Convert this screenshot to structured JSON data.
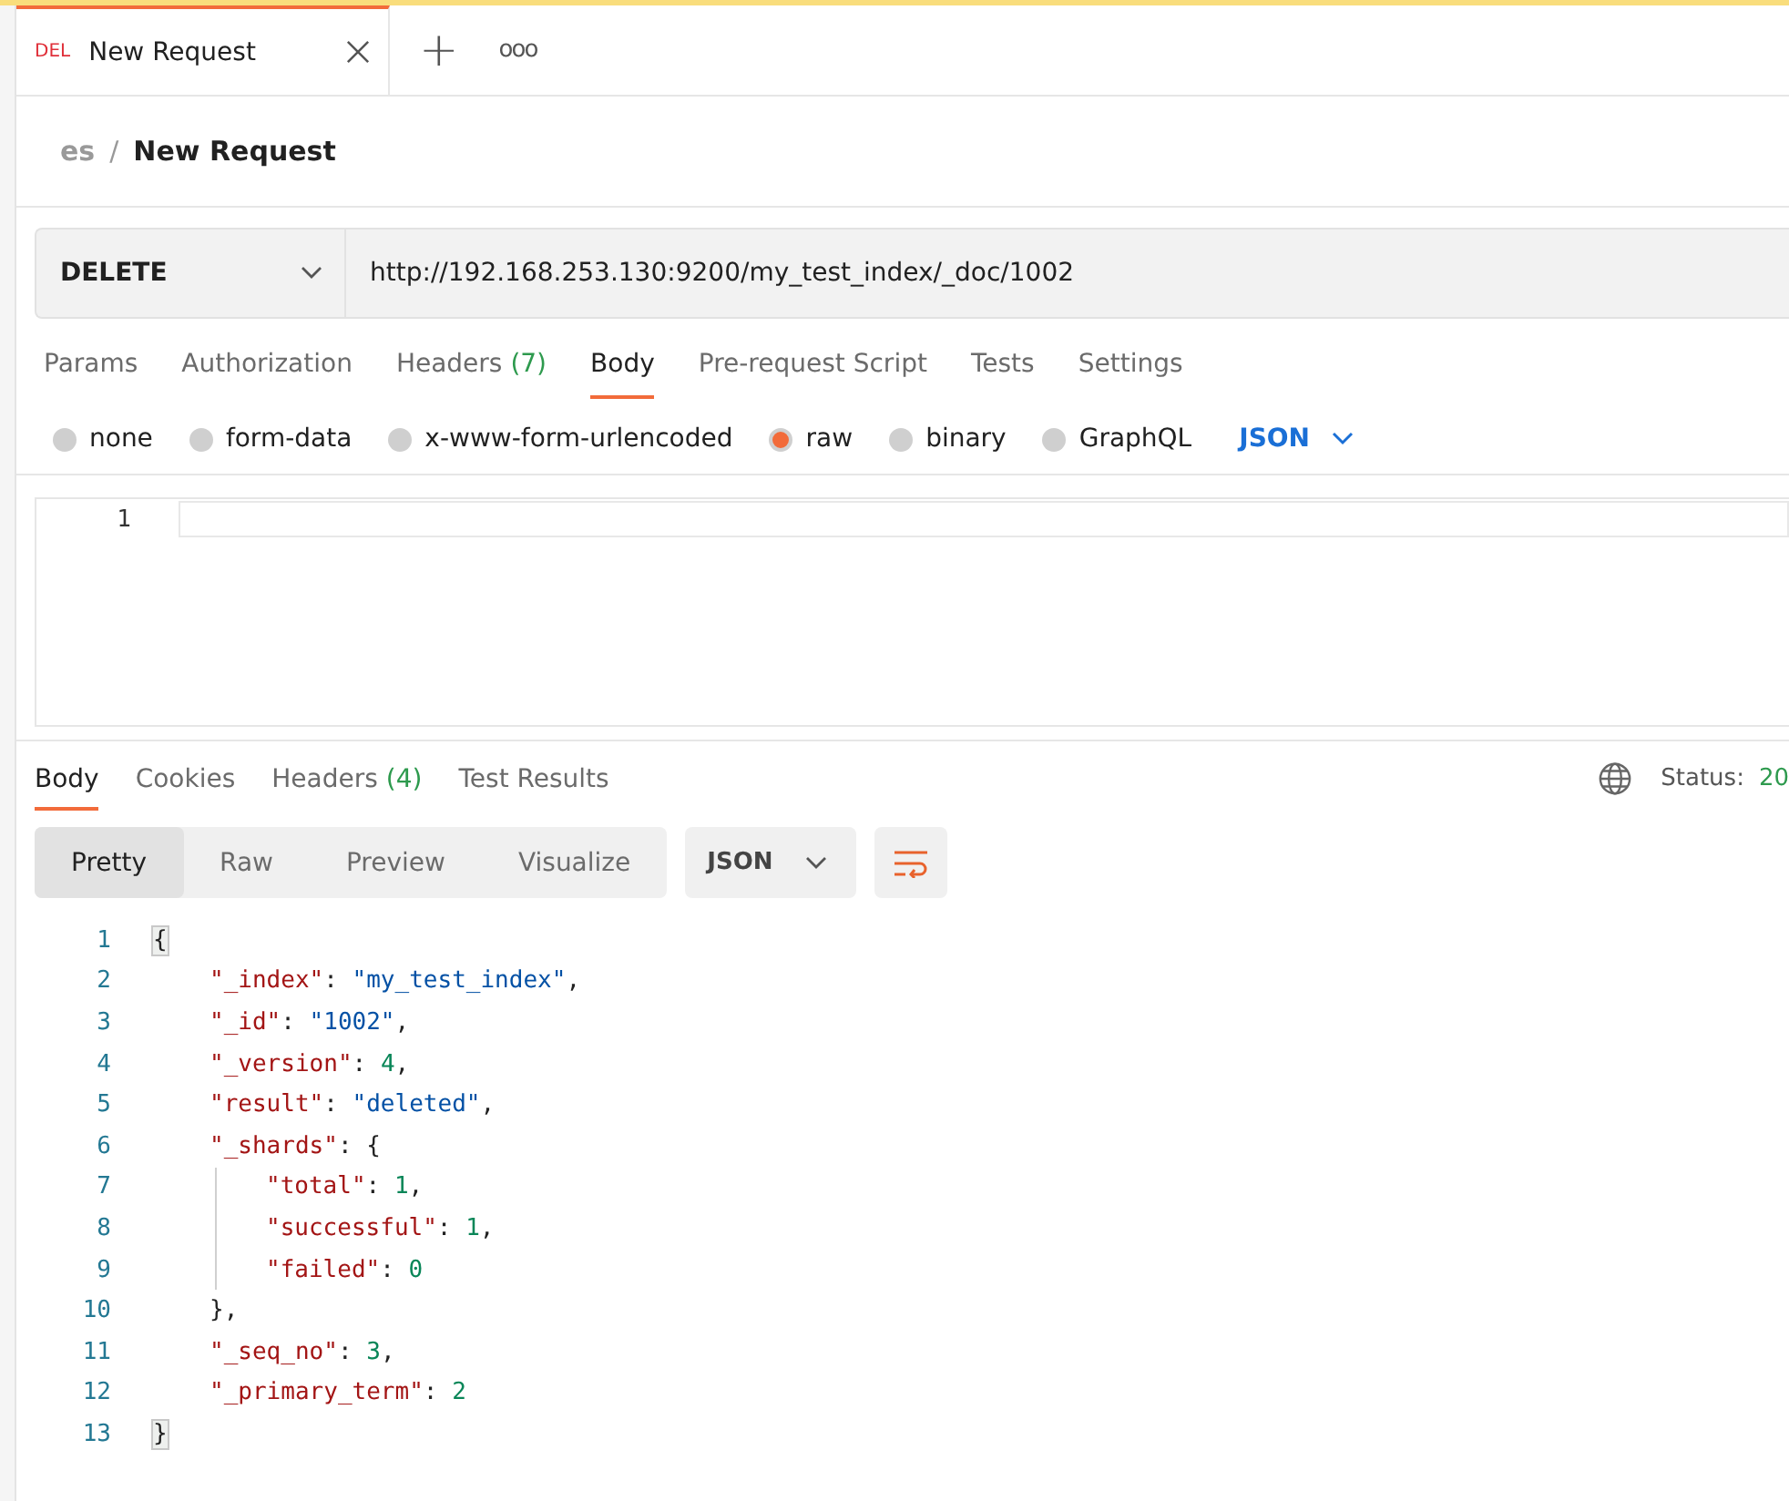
{
  "tabs": [
    {
      "method": "DEL",
      "title": "New Request",
      "selected": true
    }
  ],
  "tab_actions": {
    "new": "+",
    "more": "ooo"
  },
  "breadcrumb": {
    "parent": "es",
    "separator": "/",
    "current": "New Request"
  },
  "request": {
    "method": "DELETE",
    "url": "http://192.168.253.130:9200/my_test_index/_doc/1002"
  },
  "request_tabs": [
    {
      "label": "Params",
      "selected": false
    },
    {
      "label": "Authorization",
      "selected": false
    },
    {
      "label": "Headers",
      "count": "(7)",
      "selected": false
    },
    {
      "label": "Body",
      "selected": true
    },
    {
      "label": "Pre-request Script",
      "selected": false
    },
    {
      "label": "Tests",
      "selected": false
    },
    {
      "label": "Settings",
      "selected": false
    }
  ],
  "body_types": [
    {
      "label": "none",
      "selected": false
    },
    {
      "label": "form-data",
      "selected": false
    },
    {
      "label": "x-www-form-urlencoded",
      "selected": false
    },
    {
      "label": "raw",
      "selected": true
    },
    {
      "label": "binary",
      "selected": false
    },
    {
      "label": "GraphQL",
      "selected": false
    }
  ],
  "body_format": "JSON",
  "editor_lines": [
    "1"
  ],
  "response_tabs": [
    {
      "label": "Body",
      "selected": true
    },
    {
      "label": "Cookies",
      "selected": false
    },
    {
      "label": "Headers",
      "count": "(4)",
      "selected": false
    },
    {
      "label": "Test Results",
      "selected": false
    }
  ],
  "status": {
    "label": "Status:",
    "value": "20"
  },
  "view_modes": [
    {
      "label": "Pretty",
      "selected": true
    },
    {
      "label": "Raw",
      "selected": false
    },
    {
      "label": "Preview",
      "selected": false
    },
    {
      "label": "Visualize",
      "selected": false
    }
  ],
  "response_format": "JSON",
  "response_lines": [
    {
      "number": "1",
      "kind": "outer",
      "tokens": [
        {
          "kind": "brace-match",
          "text": "{"
        }
      ]
    },
    {
      "number": "2",
      "kind": "member",
      "tokens": [
        {
          "kind": "key",
          "text": "\"_index\""
        },
        {
          "kind": "punct",
          "text": ": "
        },
        {
          "kind": "string",
          "text": "\"my_test_index\""
        },
        {
          "kind": "punct",
          "text": ","
        }
      ]
    },
    {
      "number": "3",
      "kind": "member",
      "tokens": [
        {
          "kind": "key",
          "text": "\"_id\""
        },
        {
          "kind": "punct",
          "text": ": "
        },
        {
          "kind": "string",
          "text": "\"1002\""
        },
        {
          "kind": "punct",
          "text": ","
        }
      ]
    },
    {
      "number": "4",
      "kind": "member",
      "tokens": [
        {
          "kind": "key",
          "text": "\"_version\""
        },
        {
          "kind": "punct",
          "text": ": "
        },
        {
          "kind": "number",
          "text": "4"
        },
        {
          "kind": "punct",
          "text": ","
        }
      ]
    },
    {
      "number": "5",
      "kind": "member",
      "tokens": [
        {
          "kind": "key",
          "text": "\"result\""
        },
        {
          "kind": "punct",
          "text": ": "
        },
        {
          "kind": "string",
          "text": "\"deleted\""
        },
        {
          "kind": "punct",
          "text": ","
        }
      ]
    },
    {
      "number": "6",
      "kind": "member",
      "tokens": [
        {
          "kind": "key",
          "text": "\"_shards\""
        },
        {
          "kind": "punct",
          "text": ": {"
        }
      ]
    },
    {
      "number": "7",
      "kind": "nested",
      "tokens": [
        {
          "kind": "key",
          "text": "\"total\""
        },
        {
          "kind": "punct",
          "text": ": "
        },
        {
          "kind": "number",
          "text": "1"
        },
        {
          "kind": "punct",
          "text": ","
        }
      ]
    },
    {
      "number": "8",
      "kind": "nested",
      "tokens": [
        {
          "kind": "key",
          "text": "\"successful\""
        },
        {
          "kind": "punct",
          "text": ": "
        },
        {
          "kind": "number",
          "text": "1"
        },
        {
          "kind": "punct",
          "text": ","
        }
      ]
    },
    {
      "number": "9",
      "kind": "nested",
      "tokens": [
        {
          "kind": "key",
          "text": "\"failed\""
        },
        {
          "kind": "punct",
          "text": ": "
        },
        {
          "kind": "number",
          "text": "0"
        }
      ]
    },
    {
      "number": "10",
      "kind": "member",
      "tokens": [
        {
          "kind": "punct",
          "text": "},"
        }
      ]
    },
    {
      "number": "11",
      "kind": "member",
      "tokens": [
        {
          "kind": "key",
          "text": "\"_seq_no\""
        },
        {
          "kind": "punct",
          "text": ": "
        },
        {
          "kind": "number",
          "text": "3"
        },
        {
          "kind": "punct",
          "text": ","
        }
      ]
    },
    {
      "number": "12",
      "kind": "member",
      "tokens": [
        {
          "kind": "key",
          "text": "\"_primary_term\""
        },
        {
          "kind": "punct",
          "text": ": "
        },
        {
          "kind": "number",
          "text": "2"
        }
      ]
    },
    {
      "number": "13",
      "kind": "outer",
      "tokens": [
        {
          "kind": "brace-match",
          "text": "}"
        }
      ]
    }
  ]
}
